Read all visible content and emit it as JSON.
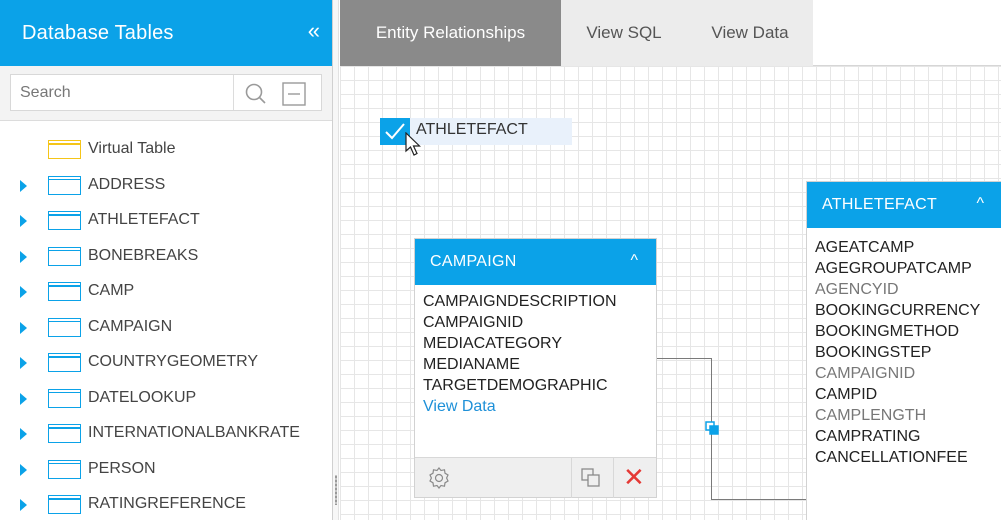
{
  "sidebar": {
    "title": "Database Tables",
    "collapse_glyph": "«",
    "search_placeholder": "Search",
    "items": [
      {
        "label": "Virtual Table",
        "type": "virtual"
      },
      {
        "label": "ADDRESS",
        "type": "table"
      },
      {
        "label": "ATHLETEFACT",
        "type": "table"
      },
      {
        "label": "BONEBREAKS",
        "type": "table"
      },
      {
        "label": "CAMP",
        "type": "table"
      },
      {
        "label": "CAMPAIGN",
        "type": "table"
      },
      {
        "label": "COUNTRYGEOMETRY",
        "type": "table"
      },
      {
        "label": "DATELOOKUP",
        "type": "table"
      },
      {
        "label": "INTERNATIONALBANKRATE",
        "type": "table"
      },
      {
        "label": "PERSON",
        "type": "table"
      },
      {
        "label": "RATINGREFERENCE",
        "type": "table"
      }
    ]
  },
  "tabs": [
    {
      "label": "Entity Relationships",
      "active": true
    },
    {
      "label": "View SQL",
      "active": false
    },
    {
      "label": "View Data",
      "active": false
    }
  ],
  "canvas": {
    "selected_table": "ATHLETEFACT",
    "campaign_card": {
      "title": "CAMPAIGN",
      "caret": "^",
      "fields": [
        "CAMPAIGNDESCRIPTION",
        "CAMPAIGNID",
        "MEDIACATEGORY",
        "MEDIANAME",
        "TARGETDEMOGRAPHIC"
      ],
      "view_data": "View Data",
      "close_glyph": "✕"
    },
    "athletefact_card": {
      "title": "ATHLETEFACT",
      "caret": "^",
      "fields": [
        {
          "name": "AGEATCAMP",
          "muted": false
        },
        {
          "name": "AGEGROUPATCAMP",
          "muted": false
        },
        {
          "name": "AGENCYID",
          "muted": true
        },
        {
          "name": "BOOKINGCURRENCY",
          "muted": false
        },
        {
          "name": "BOOKINGMETHOD",
          "muted": false
        },
        {
          "name": "BOOKINGSTEP",
          "muted": false
        },
        {
          "name": "CAMPAIGNID",
          "muted": true
        },
        {
          "name": "CAMPID",
          "muted": false
        },
        {
          "name": "CAMPLENGTH",
          "muted": true
        },
        {
          "name": "CAMPRATING",
          "muted": false
        },
        {
          "name": "CANCELLATIONFEE",
          "muted": false
        }
      ]
    }
  },
  "colors": {
    "accent": "#0ba2e8",
    "active_tab": "#8a8a8a",
    "danger": "#e53935",
    "link": "#1e90d8"
  }
}
